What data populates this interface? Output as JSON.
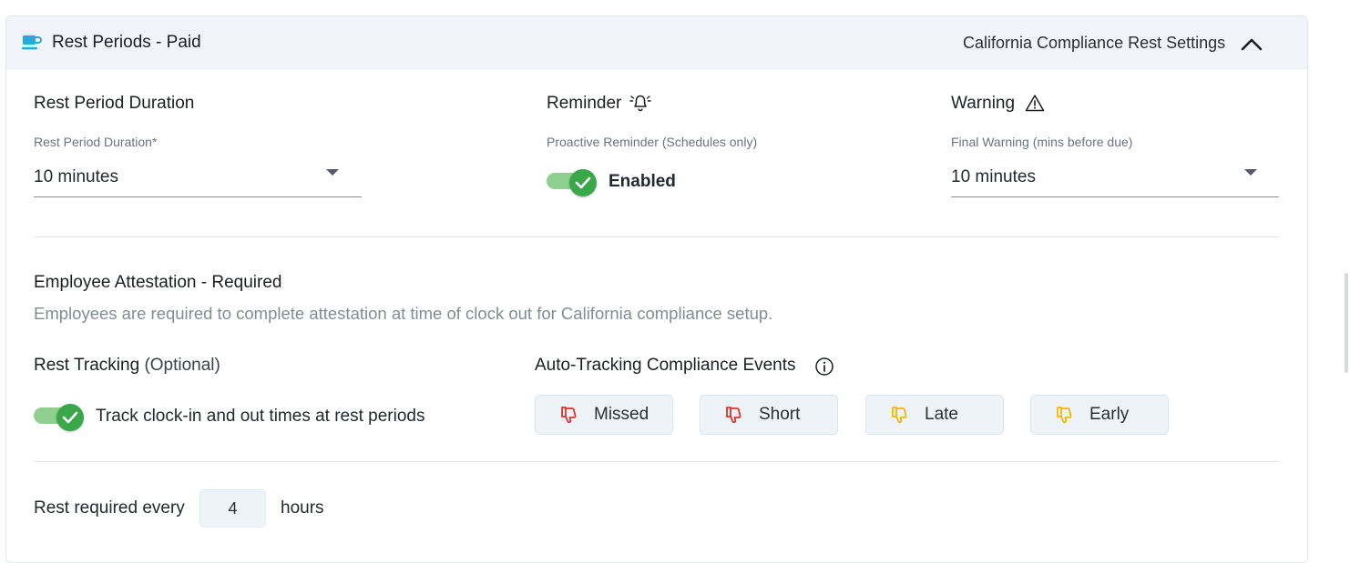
{
  "header": {
    "icon": "coffee-cup-icon",
    "title": "Rest Periods - Paid",
    "right_label": "California Compliance Rest Settings",
    "collapse_icon": "chevron-up-icon"
  },
  "duration": {
    "heading": "Rest Period Duration",
    "field_label": "Rest Period Duration*",
    "value": "10 minutes"
  },
  "reminder": {
    "heading": "Reminder",
    "icon": "bell-icon",
    "field_label": "Proactive Reminder (Schedules only)",
    "toggle_label": "Enabled",
    "toggle_on": true
  },
  "warning": {
    "heading": "Warning",
    "icon": "warning-triangle-icon",
    "field_label": "Final Warning (mins before due)",
    "value": "10 minutes"
  },
  "attestation": {
    "heading": "Employee Attestation - Required",
    "description": "Employees are required to complete attestation at time of clock out for California compliance setup."
  },
  "rest_tracking": {
    "heading": "Rest Tracking",
    "heading_suffix": "(Optional)",
    "toggle_label": "Track clock-in and out times at rest periods",
    "toggle_on": true
  },
  "auto_tracking": {
    "heading": "Auto-Tracking Compliance Events",
    "info_icon": "info-icon",
    "events": [
      {
        "label": "Missed",
        "icon": "thumbs-down-icon",
        "color": "#d9342b"
      },
      {
        "label": "Short",
        "icon": "thumbs-down-icon",
        "color": "#d9342b"
      },
      {
        "label": "Late",
        "icon": "thumbs-down-icon",
        "color": "#f2b705"
      },
      {
        "label": "Early",
        "icon": "thumbs-down-icon",
        "color": "#f2b705"
      }
    ]
  },
  "rest_required": {
    "prefix": "Rest required every",
    "value": "4",
    "suffix": "hours"
  },
  "colors": {
    "accent": "#2aa7d9",
    "toggle_on": "#3aa84a",
    "header_bg": "#f1f5f9"
  }
}
